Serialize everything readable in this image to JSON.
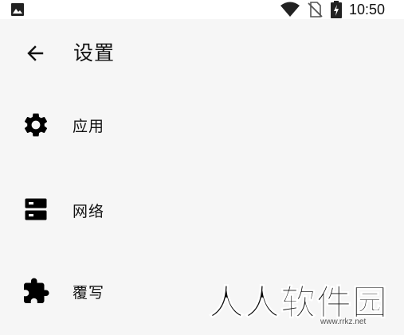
{
  "status_bar": {
    "time": "10:50",
    "icons": [
      "gallery-icon",
      "wifi-icon",
      "no-sim-icon",
      "battery-icon"
    ]
  },
  "app_bar": {
    "back_icon": "arrow-left-icon",
    "title": "设置"
  },
  "settings": [
    {
      "label": "应用",
      "icon": "gear-icon"
    },
    {
      "label": "网络",
      "icon": "server-icon"
    },
    {
      "label": "覆写",
      "icon": "puzzle-icon"
    }
  ],
  "watermark": {
    "text": "人人软件园",
    "url": "www.rrkz.net"
  },
  "colors": {
    "background": "#f6f6f6",
    "text": "#111111",
    "icon": "#000000"
  }
}
